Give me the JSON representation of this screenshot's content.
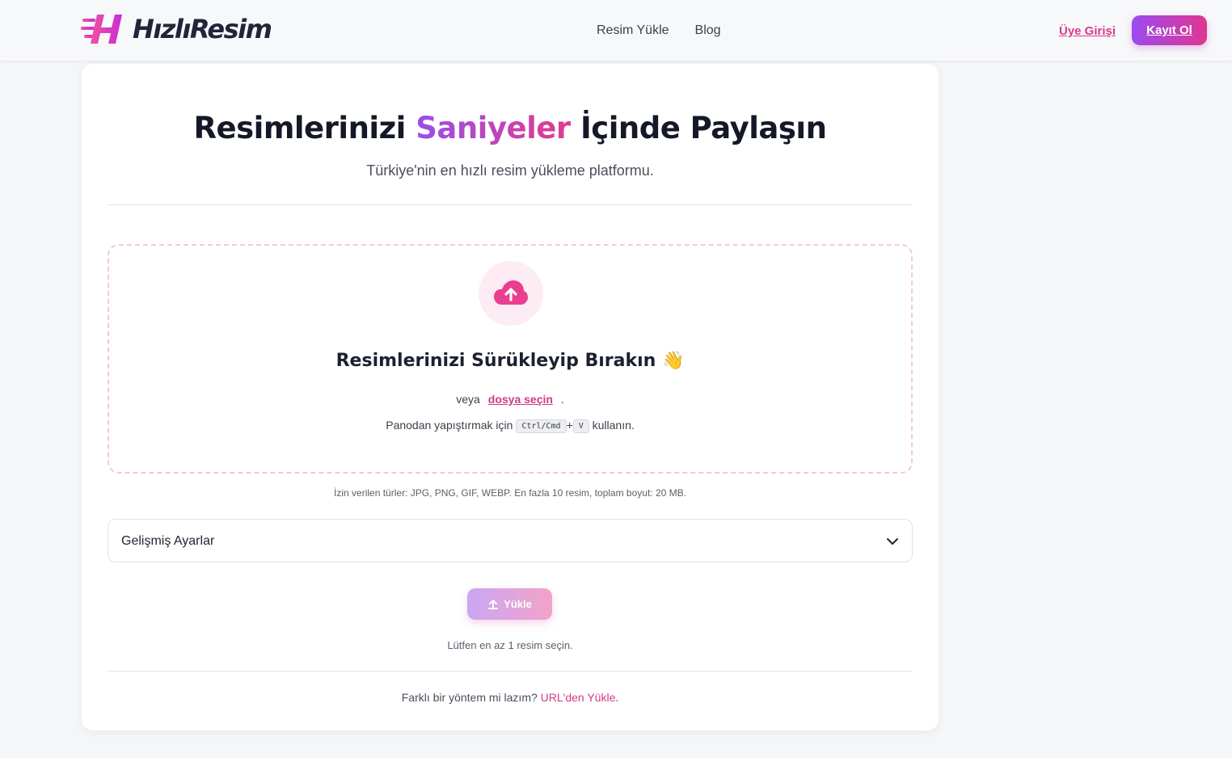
{
  "header": {
    "logo_text": "HızlıResim",
    "nav": [
      {
        "label": "Resim Yükle"
      },
      {
        "label": "Blog"
      }
    ],
    "login_label": "Üye Girişi",
    "signup_label": "Kayıt Ol"
  },
  "hero": {
    "title_before": "Resimlerinizi ",
    "title_accent": "Saniyeler",
    "title_after": " İçinde Paylaşın",
    "subtitle": "Türkiye'nin en hızlı resim yükleme platformu."
  },
  "dropzone": {
    "icon": "cloud-upload-icon",
    "title": "Resimlerinizi Sürükleyip Bırakın 👋",
    "or_text": "veya",
    "choose_link": "dosya seçin",
    "or_suffix": ".",
    "paste_prefix": "Panodan yapıştırmak için",
    "paste_key1": "Ctrl/Cmd",
    "paste_plus": "+",
    "paste_key2": "V",
    "paste_suffix": "kullanın."
  },
  "allowed_types": "İzin verilen türler: JPG, PNG, GIF, WEBP. En fazla 10 resim, toplam boyut: 20 MB.",
  "advanced": {
    "label": "Gelişmiş Ayarlar",
    "icon": "chevron-down-icon"
  },
  "upload_button": {
    "label": "Yükle",
    "icon": "upload-icon"
  },
  "hint": "Lütfen en az 1 resim seçin.",
  "alternative": {
    "prefix": "Farklı bir yöntem mi lazım?",
    "link": "URL'den Yükle",
    "suffix": "."
  },
  "colors": {
    "accent_pink": "#e0368f",
    "accent_purple": "#9b4bf0",
    "dropzone_border": "#f6c6d8"
  }
}
